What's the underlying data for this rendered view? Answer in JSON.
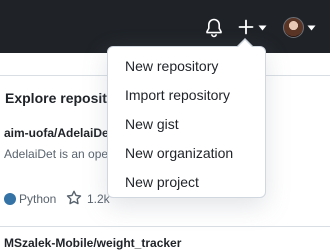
{
  "header": {
    "icons": [
      "bell-icon",
      "plus-icon",
      "chevron-down-icon",
      "avatar",
      "chevron-down-icon"
    ],
    "background": "#1f2328"
  },
  "explore": {
    "title": "Explore reposito",
    "repos": [
      {
        "name": "aim-uofa/AdelaiDe",
        "description": "AdelaiDet is an ope                                    nstance-level detection and",
        "language": "Python",
        "language_color": "#3572a5",
        "stars": "1.2k"
      },
      {
        "name": "MSzalek-Mobile/weight_tracker"
      }
    ]
  },
  "dropdown": {
    "items": [
      "New repository",
      "Import repository",
      "New gist",
      "New organization",
      "New project"
    ]
  }
}
